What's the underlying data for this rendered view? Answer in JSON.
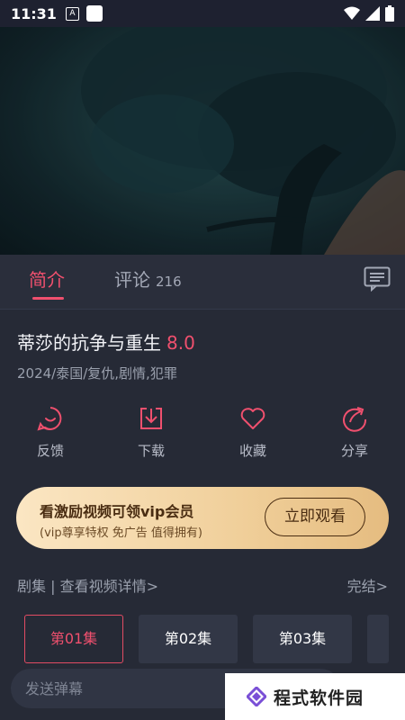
{
  "status_bar": {
    "time": "11:31",
    "notification_letter": "A"
  },
  "tabs": {
    "intro_label": "简介",
    "comments_label": "评论",
    "comments_count": "216"
  },
  "show": {
    "title": "蒂莎的抗争与重生",
    "score": "8.0",
    "tags": "2024/泰国/复仇,剧情,犯罪"
  },
  "actions": [
    {
      "label": "反馈",
      "icon": "feedback-icon"
    },
    {
      "label": "下载",
      "icon": "download-icon"
    },
    {
      "label": "收藏",
      "icon": "heart-icon"
    },
    {
      "label": "分享",
      "icon": "share-icon"
    }
  ],
  "vip_banner": {
    "title": "看激励视频可领vip会员",
    "subtitle": "(vip尊享特权 免广告 值得拥有)",
    "button_label": "立即观看"
  },
  "episodes": {
    "header_left": "剧集 | 查看视频详情>",
    "header_right": "完结>",
    "items": [
      "第01集",
      "第02集",
      "第03集"
    ],
    "selected_index": 0
  },
  "danmaku": {
    "placeholder": "发送弹幕"
  },
  "watermark": {
    "text": "程式软件园"
  },
  "colors": {
    "accent": "#f0506e",
    "background": "#262a36",
    "vip_gold": "#f0cf9a"
  }
}
